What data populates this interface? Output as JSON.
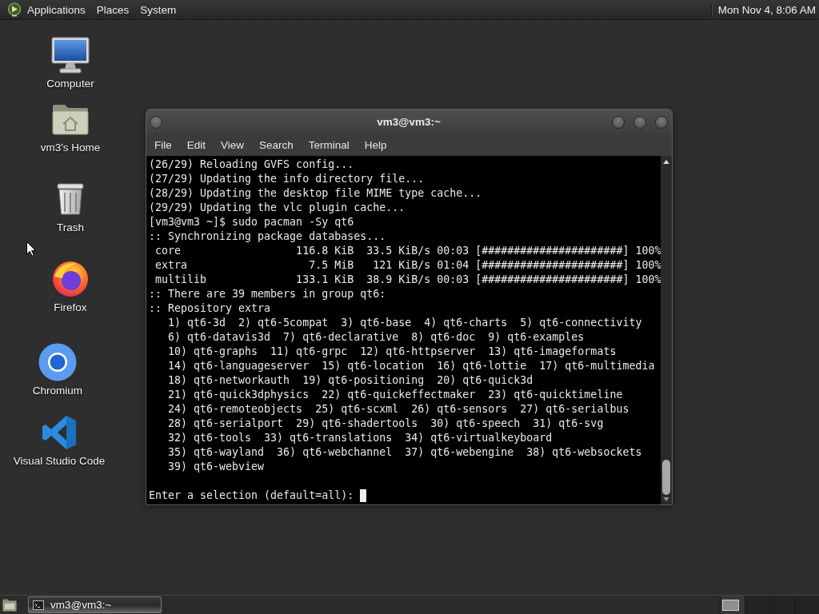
{
  "top_panel": {
    "menus": [
      "Applications",
      "Places",
      "System"
    ],
    "clock": "Mon Nov 4, 8:06 AM"
  },
  "desktop_icons": [
    {
      "kind": "computer",
      "label": "Computer"
    },
    {
      "kind": "home",
      "label": "vm3's Home"
    },
    {
      "kind": "trash",
      "label": "Trash"
    },
    {
      "kind": "firefox",
      "label": "Firefox"
    },
    {
      "kind": "chromium",
      "label": "Chromium"
    },
    {
      "kind": "vscode",
      "label": "Visual Studio Code"
    }
  ],
  "terminal_window": {
    "title": "vm3@vm3:~",
    "menu": [
      "File",
      "Edit",
      "View",
      "Search",
      "Terminal",
      "Help"
    ],
    "lines": [
      "(26/29) Reloading GVFS config...",
      "(27/29) Updating the info directory file...",
      "(28/29) Updating the desktop file MIME type cache...",
      "(29/29) Updating the vlc plugin cache...",
      "[vm3@vm3 ~]$ sudo pacman -Sy qt6",
      ":: Synchronizing package databases...",
      " core                  116.8 KiB  33.5 KiB/s 00:03 [######################] 100%",
      " extra                   7.5 MiB   121 KiB/s 01:04 [######################] 100%",
      " multilib              133.1 KiB  38.9 KiB/s 00:03 [######################] 100%",
      ":: There are 39 members in group qt6:",
      ":: Repository extra",
      "   1) qt6-3d  2) qt6-5compat  3) qt6-base  4) qt6-charts  5) qt6-connectivity",
      "   6) qt6-datavis3d  7) qt6-declarative  8) qt6-doc  9) qt6-examples",
      "   10) qt6-graphs  11) qt6-grpc  12) qt6-httpserver  13) qt6-imageformats",
      "   14) qt6-languageserver  15) qt6-location  16) qt6-lottie  17) qt6-multimedia",
      "   18) qt6-networkauth  19) qt6-positioning  20) qt6-quick3d",
      "   21) qt6-quick3dphysics  22) qt6-quickeffectmaker  23) qt6-quicktimeline",
      "   24) qt6-remoteobjects  25) qt6-scxml  26) qt6-sensors  27) qt6-serialbus",
      "   28) qt6-serialport  29) qt6-shadertools  30) qt6-speech  31) qt6-svg",
      "   32) qt6-tools  33) qt6-translations  34) qt6-virtualkeyboard",
      "   35) qt6-wayland  36) qt6-webchannel  37) qt6-webengine  38) qt6-websockets",
      "   39) qt6-webview"
    ],
    "prompt": "Enter a selection (default=all):"
  },
  "bottom_panel": {
    "tasks": [
      {
        "label": "vm3@vm3:~",
        "selected": true
      }
    ],
    "workspaces": [
      {
        "selected": true
      },
      {
        "selected": false
      },
      {
        "selected": false
      },
      {
        "selected": false
      }
    ]
  }
}
